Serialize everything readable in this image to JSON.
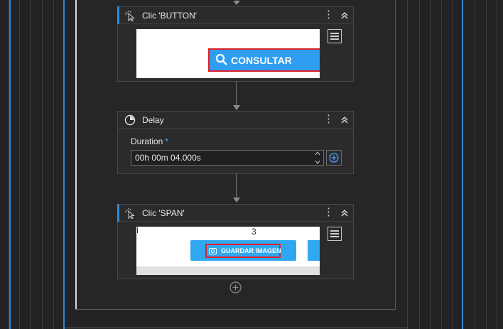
{
  "step1": {
    "title": "Clic 'BUTTON'",
    "preview": {
      "button_label": "CONSULTAR"
    }
  },
  "step2": {
    "title": "Delay",
    "field_label": "Duration",
    "required_mark": "*",
    "value": "00h 00m 04.000s"
  },
  "step3": {
    "title": "Clic 'SPAN'",
    "preview": {
      "page_number": "3",
      "button_label": "GUARDAR IMAGEN"
    }
  },
  "icons": {
    "click": "cursor-click-icon",
    "delay": "clock-icon",
    "menu": "more-vertical-icon",
    "collapse": "chevrons-up-icon",
    "search": "search-icon",
    "add": "plus-circle-icon",
    "hamburger": "hamburger-menu-icon"
  },
  "colors": {
    "accent": "#2f8ad6",
    "button_blue": "#2f9ef0",
    "highlight_red": "#e0202a"
  }
}
